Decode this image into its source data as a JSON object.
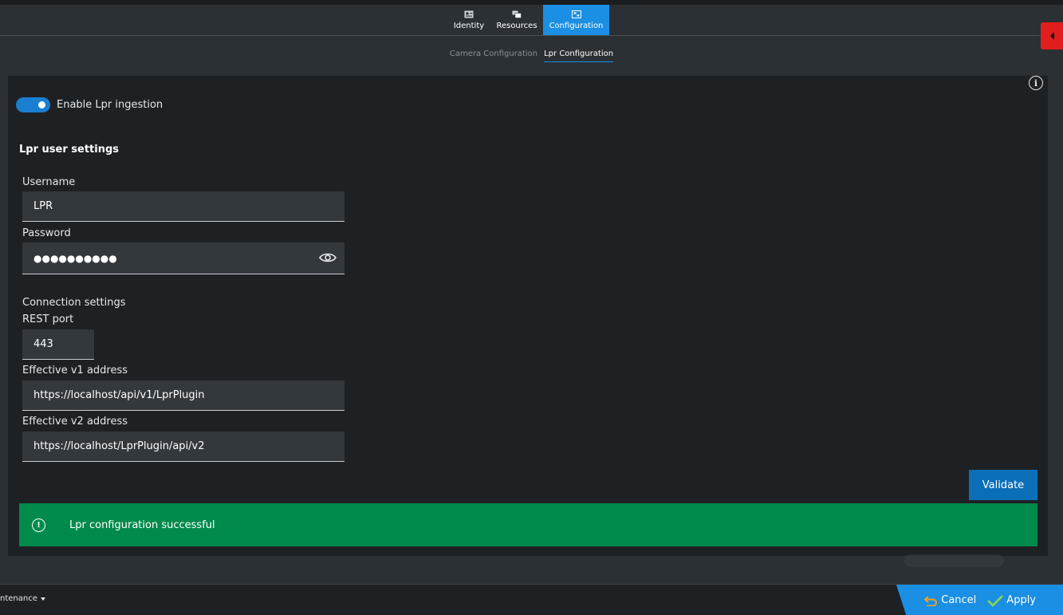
{
  "top_tabs": [
    {
      "label": "Identity",
      "icon": "identity-icon"
    },
    {
      "label": "Resources",
      "icon": "resources-icon"
    },
    {
      "label": "Configuration",
      "icon": "configuration-icon",
      "active": true
    }
  ],
  "sub_tabs": [
    {
      "label": "Camera Configuration"
    },
    {
      "label": "Lpr Configuration",
      "active": true
    }
  ],
  "info_icon": "i",
  "toggle": {
    "label": "Enable Lpr ingestion",
    "enabled": true
  },
  "user_settings": {
    "title": "Lpr user settings",
    "username_label": "Username",
    "username_value": "LPR",
    "password_label": "Password",
    "password_value": "●●●●●●●●●●"
  },
  "connection": {
    "title": "Connection settings",
    "rest_port_label": "REST port",
    "rest_port_value": "443",
    "v1_label": "Effective v1 address",
    "v1_value": "https://localhost/api/v1/LprPlugin",
    "v2_label": "Effective v2 address",
    "v2_value": "https://localhost/LprPlugin/api/v2"
  },
  "validate_label": "Validate",
  "status": {
    "icon": "!",
    "message": "Lpr configuration successful"
  },
  "footer": {
    "maintenance_label": "ntenance",
    "cancel_label": "Cancel",
    "apply_label": "Apply"
  },
  "colors": {
    "accent": "#1a8fe3",
    "success": "#008a4c",
    "alert_tab": "#e11d1d"
  }
}
